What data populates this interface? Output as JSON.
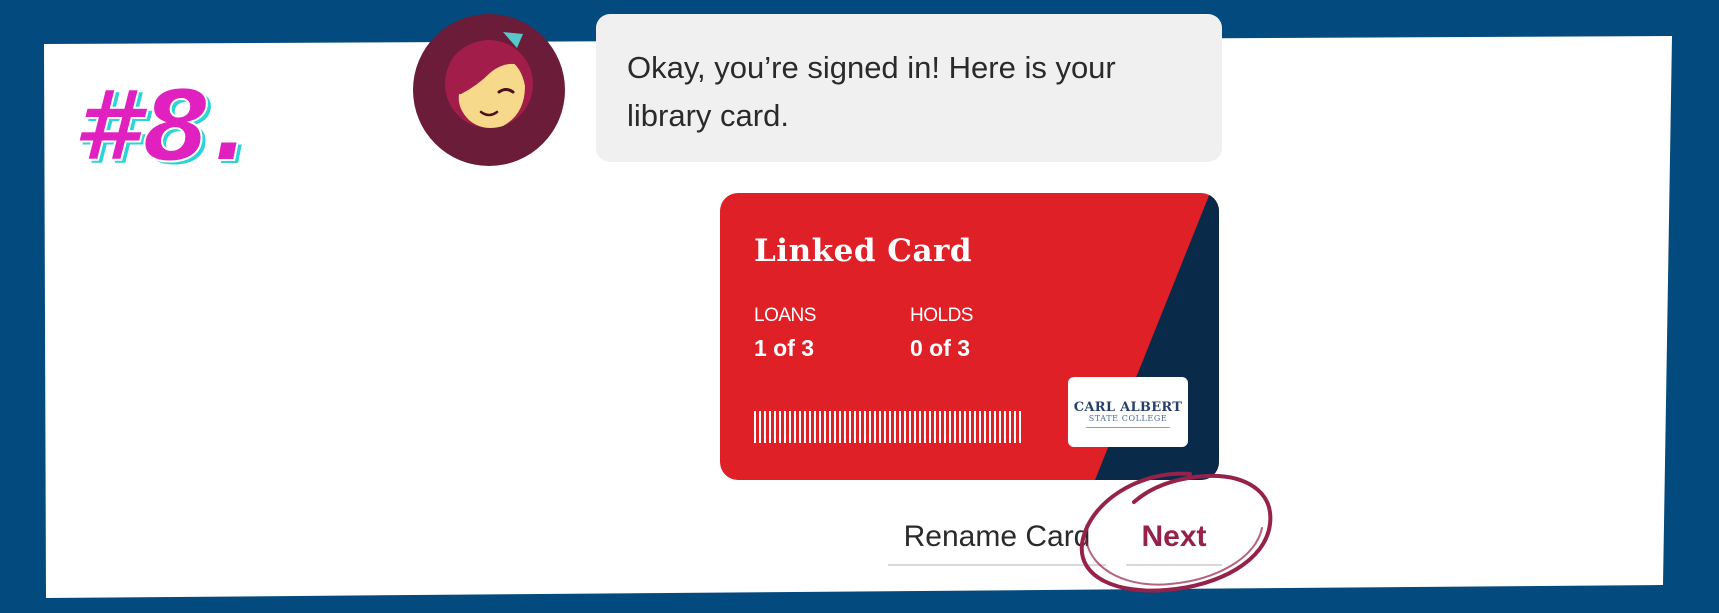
{
  "step_label": "#8.",
  "chat": {
    "message": "Okay, you’re signed in! Here is your library card."
  },
  "card": {
    "title": "Linked Card",
    "loans_label": "LOANS",
    "loans_value": "1 of 3",
    "holds_label": "HOLDS",
    "holds_value": "0 of 3",
    "library_logo_line1": "CARL ALBERT",
    "library_logo_line2": "STATE COLLEGE"
  },
  "actions": {
    "rename_label": "Rename Card",
    "next_label": "Next"
  },
  "colors": {
    "frame": "#034a7e",
    "card_red": "#e02027",
    "card_navy": "#0a2a4a",
    "accent": "#96214a",
    "step_label": "#e021c0",
    "step_shadow": "#2bd4d6"
  },
  "icons": {
    "avatar": "libby-avatar-icon",
    "barcode": "barcode-icon",
    "annotation": "circle-highlight-icon"
  }
}
